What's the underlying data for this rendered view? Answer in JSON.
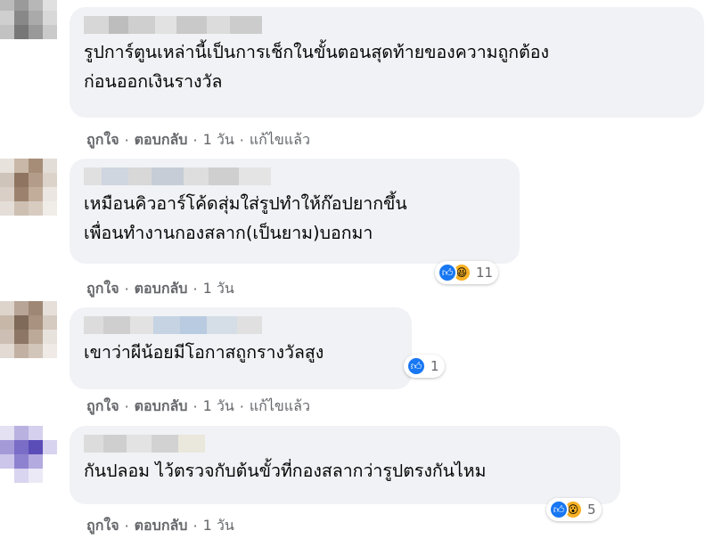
{
  "comments": [
    {
      "text": "รูปการ์ตูนเหล่านี้เป็นการเช็กในขั้นตอนสุดท้ายของความถูกต้อง\nก่อนออกเงินรางวัล",
      "actions": {
        "like": "ถูกใจ",
        "reply": "ตอบกลับ",
        "time": "1 วัน",
        "edited": "แก้ไขแล้ว"
      }
    },
    {
      "text": "เหมือนคิวอาร์โค้ดสุ่มใส่รูปทำให้ก๊อปยากขึ้น\nเพื่อนทำงานกองสลาก(เป็นยาม)บอกมา",
      "actions": {
        "like": "ถูกใจ",
        "reply": "ตอบกลับ",
        "time": "1 วัน"
      },
      "reactions": {
        "types": [
          "like-icon",
          "haha-icon"
        ],
        "count": "11"
      }
    },
    {
      "text": "เขาว่าผีน้อยมีโอกาสถูกรางวัลสูง",
      "actions": {
        "like": "ถูกใจ",
        "reply": "ตอบกลับ",
        "time": "1 วัน",
        "edited": "แก้ไขแล้ว"
      },
      "reactions": {
        "types": [
          "like-icon"
        ],
        "count": "1"
      }
    },
    {
      "text": "กันปลอม ไว้ตรวจกับต้นขั้วที่กองสลากว่ารูปตรงกันไหม",
      "actions": {
        "like": "ถูกใจ",
        "reply": "ตอบกลับ",
        "time": "1 วัน"
      },
      "reactions": {
        "types": [
          "like-icon",
          "wow-icon"
        ],
        "count": "5"
      }
    }
  ],
  "colors": {
    "bubble": "#f0f2f5",
    "text": "#050505",
    "meta": "#65676b",
    "like": "#1877f2",
    "emoji": "#f7b125"
  }
}
